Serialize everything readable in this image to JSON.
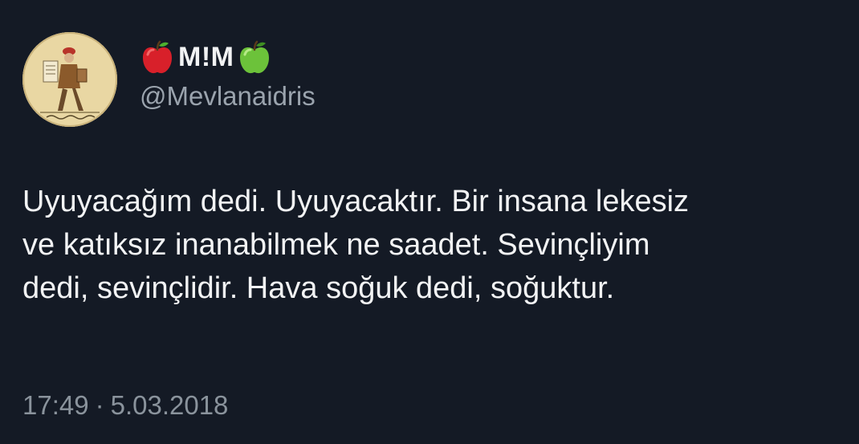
{
  "author": {
    "display_name": "M!M",
    "handle": "@Mevlanaidris",
    "name_prefix_icon": "red-apple-icon",
    "name_suffix_icon": "green-apple-icon"
  },
  "tweet": {
    "lines": [
      "Uyuyacağım dedi. Uyuyacaktır. Bir insana lekesiz",
      "ve katıksız inanabilmek ne saadet. Sevinçliyim",
      "dedi, sevinçlidir. Hava soğuk dedi, soğuktur."
    ],
    "time": "17:49",
    "separator": "·",
    "date": "5.03.2018"
  },
  "colors": {
    "background": "#141a25",
    "text": "#f2f3f4",
    "muted": "#9aa3ad",
    "red_apple": "#d8202a",
    "green_apple": "#6cc23a"
  }
}
